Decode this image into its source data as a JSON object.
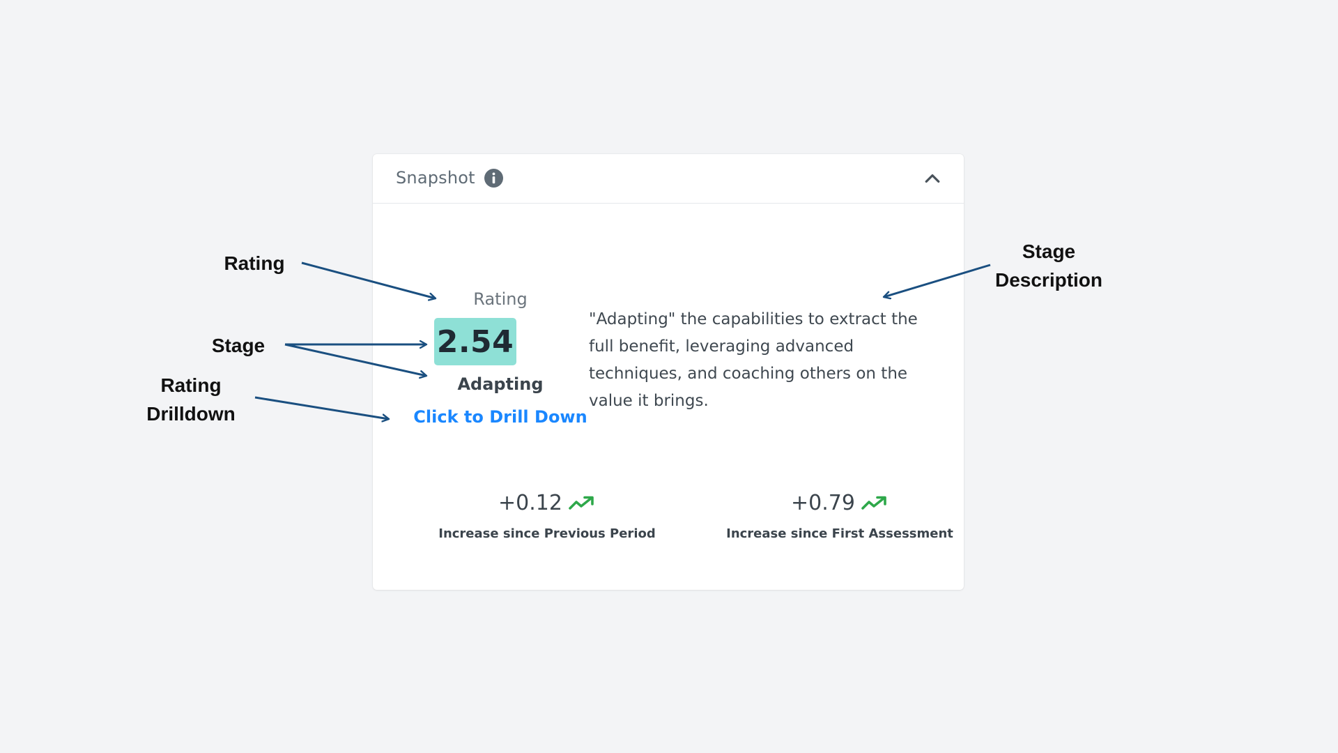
{
  "card": {
    "title": "Snapshot",
    "info_icon": "info-icon",
    "collapse_icon": "chevron-up-icon"
  },
  "rating": {
    "label": "Rating",
    "value": "2.54",
    "stage": "Adapting",
    "drill_link": "Click to Drill Down",
    "box_color": "#8ee0d6"
  },
  "description": {
    "text": "\"Adapting\" the capabilities to extract the full benefit, leveraging advanced techniques, and coaching others on the value it brings."
  },
  "metrics": [
    {
      "value": "+0.12",
      "label": "Increase since Previous Period",
      "trend_icon": "trending-up-icon"
    },
    {
      "value": "+0.79",
      "label": "Increase since First Assessment",
      "trend_icon": "trending-up-icon"
    }
  ],
  "annotations": {
    "rating": "Rating",
    "stage": "Stage",
    "rating_drilldown_line1": "Rating",
    "rating_drilldown_line2": "Drilldown",
    "stage_description_line1": "Stage",
    "stage_description_line2": "Description"
  },
  "colors": {
    "link": "#1a87ff",
    "trend_up": "#2ea84a",
    "arrow": "#1a4f80",
    "background": "#f3f4f6"
  }
}
